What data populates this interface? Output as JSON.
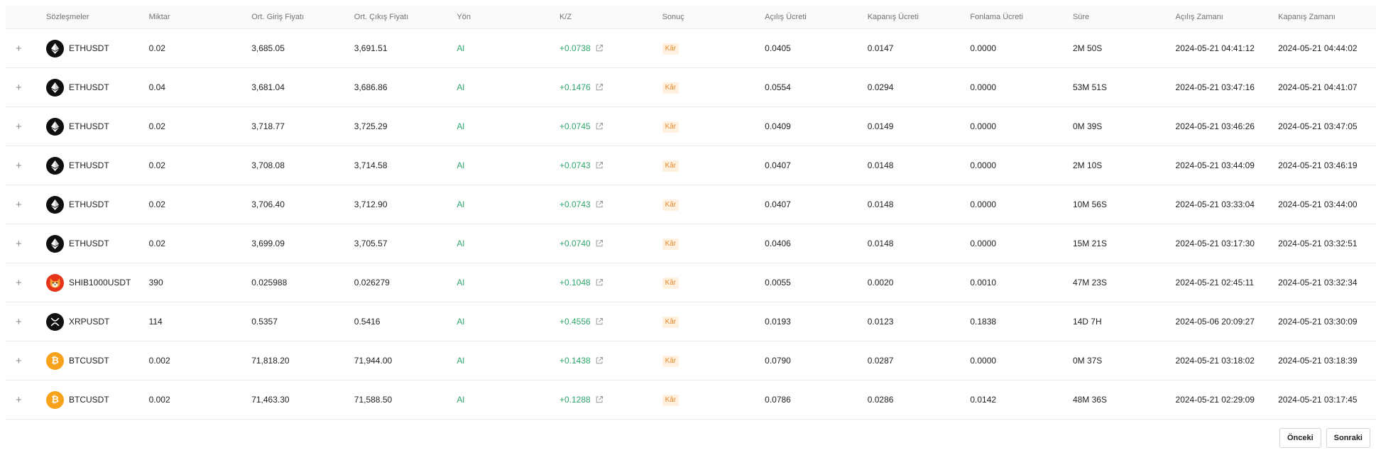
{
  "headers": [
    "Sözleşmeler",
    "Miktar",
    "Ort. Giriş Fiyatı",
    "Ort. Çıkış Fiyatı",
    "Yön",
    "K/Z",
    "Sonuç",
    "Açılış Ücreti",
    "Kapanış Ücreti",
    "Fonlama Ücreti",
    "Süre",
    "Açılış Zamanı",
    "Kapanış Zamanı"
  ],
  "rows": [
    {
      "symbol": "ETHUSDT",
      "coin": "eth",
      "icon": "ethereum-icon",
      "qty": "0.02",
      "entry": "3,685.05",
      "exit": "3,691.51",
      "side": "Al",
      "pnl": "+0.0738",
      "result": "Kâr",
      "open_fee": "0.0405",
      "close_fee": "0.0147",
      "funding": "0.0000",
      "duration": "2M 50S",
      "open_time": "2024-05-21 04:41:12",
      "close_time": "2024-05-21 04:44:02"
    },
    {
      "symbol": "ETHUSDT",
      "coin": "eth",
      "icon": "ethereum-icon",
      "qty": "0.04",
      "entry": "3,681.04",
      "exit": "3,686.86",
      "side": "Al",
      "pnl": "+0.1476",
      "result": "Kâr",
      "open_fee": "0.0554",
      "close_fee": "0.0294",
      "funding": "0.0000",
      "duration": "53M 51S",
      "open_time": "2024-05-21 03:47:16",
      "close_time": "2024-05-21 04:41:07"
    },
    {
      "symbol": "ETHUSDT",
      "coin": "eth",
      "icon": "ethereum-icon",
      "qty": "0.02",
      "entry": "3,718.77",
      "exit": "3,725.29",
      "side": "Al",
      "pnl": "+0.0745",
      "result": "Kâr",
      "open_fee": "0.0409",
      "close_fee": "0.0149",
      "funding": "0.0000",
      "duration": "0M 39S",
      "open_time": "2024-05-21 03:46:26",
      "close_time": "2024-05-21 03:47:05"
    },
    {
      "symbol": "ETHUSDT",
      "coin": "eth",
      "icon": "ethereum-icon",
      "qty": "0.02",
      "entry": "3,708.08",
      "exit": "3,714.58",
      "side": "Al",
      "pnl": "+0.0743",
      "result": "Kâr",
      "open_fee": "0.0407",
      "close_fee": "0.0148",
      "funding": "0.0000",
      "duration": "2M 10S",
      "open_time": "2024-05-21 03:44:09",
      "close_time": "2024-05-21 03:46:19"
    },
    {
      "symbol": "ETHUSDT",
      "coin": "eth",
      "icon": "ethereum-icon",
      "qty": "0.02",
      "entry": "3,706.40",
      "exit": "3,712.90",
      "side": "Al",
      "pnl": "+0.0743",
      "result": "Kâr",
      "open_fee": "0.0407",
      "close_fee": "0.0148",
      "funding": "0.0000",
      "duration": "10M 56S",
      "open_time": "2024-05-21 03:33:04",
      "close_time": "2024-05-21 03:44:00"
    },
    {
      "symbol": "ETHUSDT",
      "coin": "eth",
      "icon": "ethereum-icon",
      "qty": "0.02",
      "entry": "3,699.09",
      "exit": "3,705.57",
      "side": "Al",
      "pnl": "+0.0740",
      "result": "Kâr",
      "open_fee": "0.0406",
      "close_fee": "0.0148",
      "funding": "0.0000",
      "duration": "15M 21S",
      "open_time": "2024-05-21 03:17:30",
      "close_time": "2024-05-21 03:32:51"
    },
    {
      "symbol": "SHIB1000USDT",
      "coin": "shib",
      "icon": "shiba-inu-icon",
      "qty": "390",
      "entry": "0.025988",
      "exit": "0.026279",
      "side": "Al",
      "pnl": "+0.1048",
      "result": "Kâr",
      "open_fee": "0.0055",
      "close_fee": "0.0020",
      "funding": "0.0010",
      "duration": "47M 23S",
      "open_time": "2024-05-21 02:45:11",
      "close_time": "2024-05-21 03:32:34"
    },
    {
      "symbol": "XRPUSDT",
      "coin": "xrp",
      "icon": "xrp-icon",
      "qty": "114",
      "entry": "0.5357",
      "exit": "0.5416",
      "side": "Al",
      "pnl": "+0.4556",
      "result": "Kâr",
      "open_fee": "0.0193",
      "close_fee": "0.0123",
      "funding": "0.1838",
      "duration": "14D 7H",
      "open_time": "2024-05-06 20:09:27",
      "close_time": "2024-05-21 03:30:09"
    },
    {
      "symbol": "BTCUSDT",
      "coin": "btc",
      "icon": "bitcoin-icon",
      "qty": "0.002",
      "entry": "71,818.20",
      "exit": "71,944.00",
      "side": "Al",
      "pnl": "+0.1438",
      "result": "Kâr",
      "open_fee": "0.0790",
      "close_fee": "0.0287",
      "funding": "0.0000",
      "duration": "0M 37S",
      "open_time": "2024-05-21 03:18:02",
      "close_time": "2024-05-21 03:18:39"
    },
    {
      "symbol": "BTCUSDT",
      "coin": "btc",
      "icon": "bitcoin-icon",
      "qty": "0.002",
      "entry": "71,463.30",
      "exit": "71,588.50",
      "side": "Al",
      "pnl": "+0.1288",
      "result": "Kâr",
      "open_fee": "0.0786",
      "close_fee": "0.0286",
      "funding": "0.0142",
      "duration": "48M 36S",
      "open_time": "2024-05-21 02:29:09",
      "close_time": "2024-05-21 03:17:45"
    }
  ],
  "pagination": {
    "prev": "Önceki",
    "next": "Sonraki"
  },
  "colors": {
    "profit": "#2ea56b",
    "badge_bg": "#fff1e0",
    "badge_text": "#e3892a"
  }
}
